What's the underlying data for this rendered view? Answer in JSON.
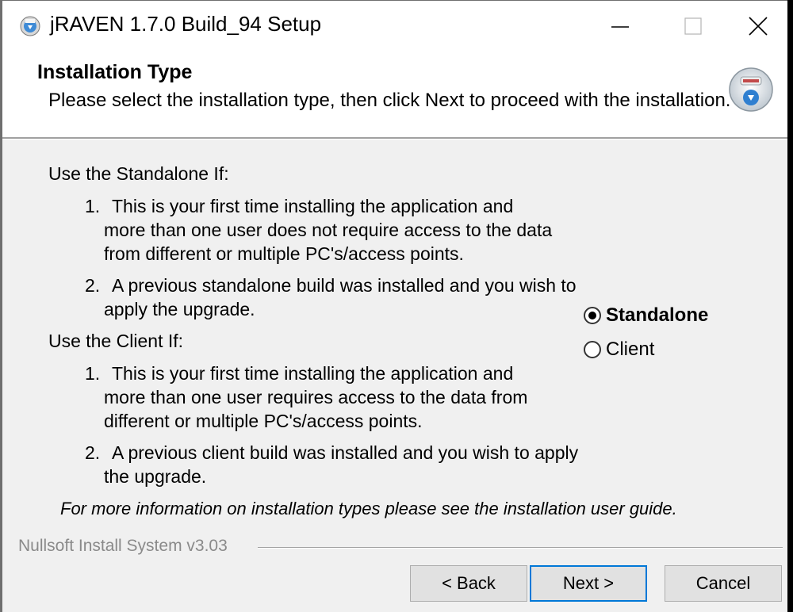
{
  "window": {
    "title": "jRAVEN 1.7.0 Build_94 Setup",
    "controls": {
      "minimize": "minimize",
      "maximize": "maximize",
      "close": "close"
    }
  },
  "header": {
    "title": "Installation Type",
    "subtitle": "Please select the installation type, then click Next to proceed with the installation."
  },
  "content": {
    "standalone_heading": "Use the Standalone If:",
    "standalone_items": [
      {
        "number": "1.",
        "lines": [
          "This is your first time installing the application and",
          "more than one user does not require access to the data",
          "from different or multiple PC's/access points."
        ]
      },
      {
        "number": "2.",
        "lines": [
          "A previous standalone build was installed and you wish to",
          "apply the upgrade."
        ]
      }
    ],
    "client_heading": "Use the Client If:",
    "client_items": [
      {
        "number": "1.",
        "lines": [
          "This is your first time installing the application and",
          "more than one user requires access to the data from",
          "different or multiple PC's/access points."
        ]
      },
      {
        "number": "2.",
        "lines": [
          "A previous client build was installed and you wish to apply",
          "the upgrade."
        ]
      }
    ],
    "footnote": "For more information on installation types please see the installation user guide."
  },
  "options": {
    "selected": "Standalone",
    "items": [
      "Standalone",
      "Client"
    ]
  },
  "footer": {
    "brand": "Nullsoft Install System v3.03",
    "back_label": "< Back",
    "next_label": "Next >",
    "cancel_label": "Cancel"
  },
  "colors": {
    "accent": "#0078d7",
    "header_bg": "#ffffff",
    "body_bg": "#f0f0f0",
    "muted_text": "#8a8a8a"
  },
  "icons": {
    "app": "setup-disc-icon",
    "header": "installer-disc-icon"
  }
}
